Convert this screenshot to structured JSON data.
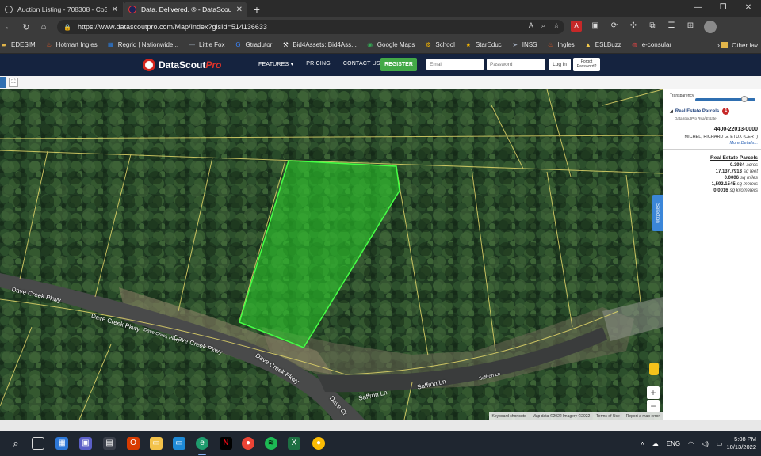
{
  "browser": {
    "tabs": [
      {
        "title": "Auction Listing - 708308 - CoSt...",
        "active": false
      },
      {
        "title": "Data. Delivered. ® - DataScoutPro",
        "active": true
      }
    ],
    "new_tab": "+",
    "url": "https://www.datascoutpro.com/Map/Index?gisId=514136633"
  },
  "bookmarks": [
    {
      "label": "EDESIM",
      "icon": "folder-icon",
      "color": "#e2b54a"
    },
    {
      "label": "Hotmart Ingles",
      "icon": "flame-icon",
      "color": "#f15a24"
    },
    {
      "label": "Regrid | Nationwide...",
      "icon": "map-icon",
      "color": "#2a7de1"
    },
    {
      "label": "Little Fox",
      "icon": "line-icon",
      "color": "#9aa4b2"
    },
    {
      "label": "Gtradutor",
      "icon": "translate-icon",
      "color": "#3b82f6"
    },
    {
      "label": "Bid4Assets: Bid4Ass...",
      "icon": "gavel-icon",
      "color": "#ffffff"
    },
    {
      "label": "Google Maps",
      "icon": "pin-icon",
      "color": "#34a853"
    },
    {
      "label": "School",
      "icon": "gear-icon",
      "color": "#f5b400"
    },
    {
      "label": "StarEduc",
      "icon": "star-icon",
      "color": "#f5b400"
    },
    {
      "label": "INSS",
      "icon": "arrow-icon",
      "color": "#9aa4b2"
    },
    {
      "label": "Ingles",
      "icon": "flame-icon",
      "color": "#f15a24"
    },
    {
      "label": "ESLBuzz",
      "icon": "hat-icon",
      "color": "#f2c94c"
    },
    {
      "label": "e-consular",
      "icon": "globe-icon",
      "color": "#d44"
    }
  ],
  "bookmarks_other": "Other fav",
  "site": {
    "logo_main": "DataScout",
    "logo_pro": "Pro",
    "nav": [
      "FEATURES ▾",
      "PRICING",
      "CONTACT US"
    ],
    "register": "REGISTER",
    "email_placeholder": "Email",
    "password_placeholder": "Password",
    "login": "Log in",
    "forgot": "Forgot Password?"
  },
  "map": {
    "road_labels": [
      "Dave Creek Pkwy",
      "Dave Creek Pkwy",
      "Dave Creek Pkwy",
      "Dave Creek Pkwy",
      "Dave Creek Pkwy",
      "Dave Cr",
      "Saffron Ln",
      "Saffron Ln",
      "Saffron Ln"
    ],
    "selection_tab": "Selection",
    "zoom_in": "+",
    "zoom_out": "−",
    "attribution": [
      "Keyboard shortcuts",
      "Map data ©2022 Imagery ©2022",
      "Terms of Use",
      "Report a map error"
    ]
  },
  "panel": {
    "transparency_label": "Transparency",
    "transparency_value": 0.82,
    "layer_title": "Real Estate Parcels",
    "layer_count": "1",
    "layer_source": "DataScoutPro Real Estate",
    "parcel_id": "4400-22013-0000",
    "owner": "MICHEL, RICHARD G. ETUX (CERT)",
    "more_details": "More Details...",
    "area_heading": "Real Estate Parcels",
    "areas": [
      {
        "value": "0.3934",
        "unit": "acres"
      },
      {
        "value": "17,137.7913",
        "unit": "sq feet"
      },
      {
        "value": "0.0006",
        "unit": "sq miles"
      },
      {
        "value": "1,592.1545",
        "unit": "sq meters"
      },
      {
        "value": "0.0016",
        "unit": "sq kilometers"
      }
    ]
  },
  "taskbar": {
    "icons": [
      "search-icon",
      "task-view-icon",
      "widgets-icon",
      "teams-icon",
      "store-icon",
      "office-icon",
      "explorer-icon",
      "remote-icon",
      "edge-icon",
      "netflix-icon",
      "chrome-icon",
      "spotify-icon",
      "excel-icon",
      "chrome-alt-icon"
    ],
    "language": "ENG",
    "time": "5:08 PM",
    "date": "10/13/2022"
  }
}
